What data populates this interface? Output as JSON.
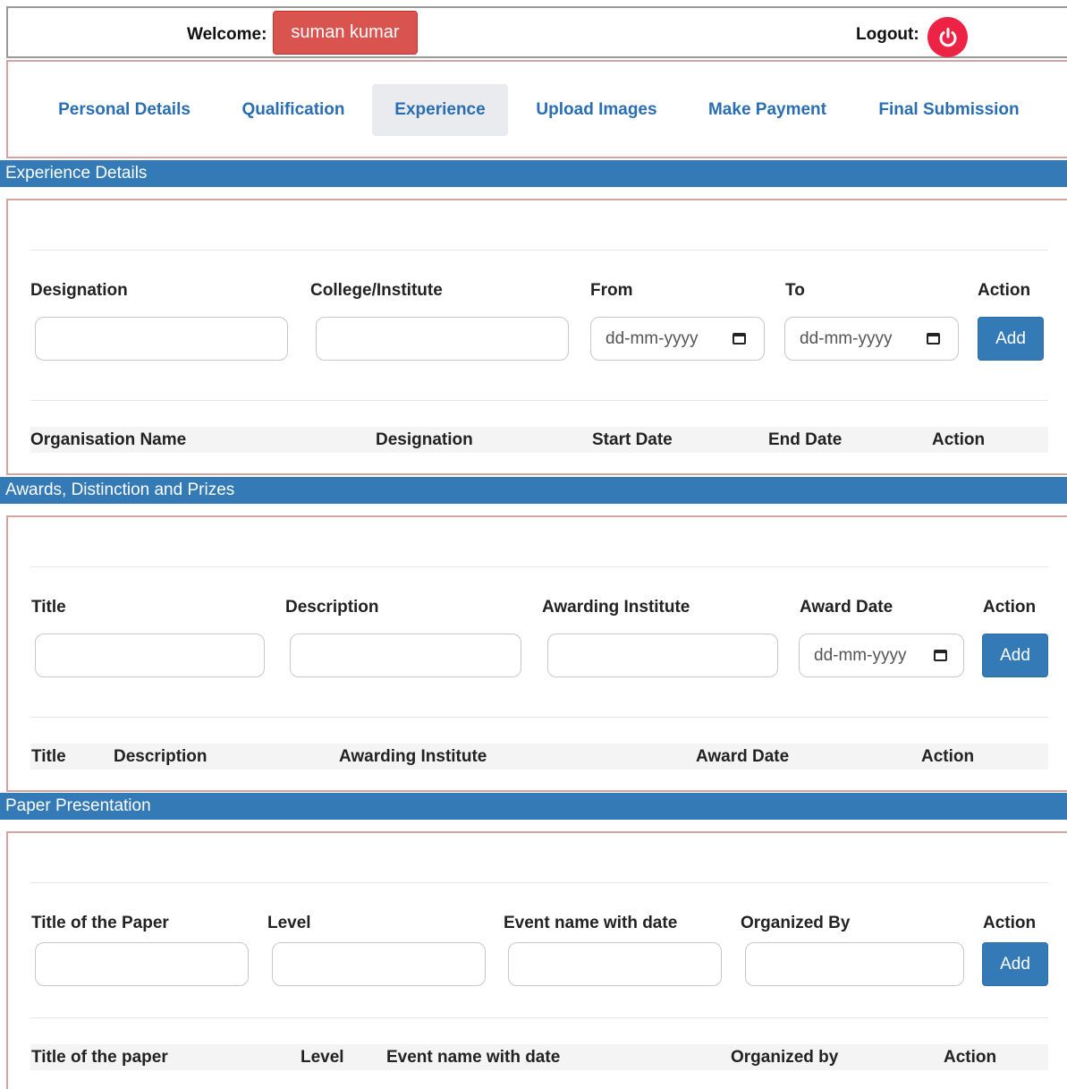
{
  "header": {
    "welcome_label": "Welcome:",
    "user_name": "suman kumar",
    "logout_label": "Logout:",
    "logout_icon": "power-icon"
  },
  "tabs": [
    {
      "label": "Personal Details",
      "active": false
    },
    {
      "label": "Qualification",
      "active": false
    },
    {
      "label": "Experience",
      "active": true
    },
    {
      "label": "Upload Images",
      "active": false
    },
    {
      "label": "Make Payment",
      "active": false
    },
    {
      "label": "Final Submission",
      "active": false
    }
  ],
  "experience": {
    "section_title": "Experience Details",
    "form_labels": [
      "Designation",
      "College/Institute",
      "From",
      "To",
      "Action"
    ],
    "from_placeholder": "dd-mm-yyyy",
    "to_placeholder": "dd-mm-yyyy",
    "add_label": "Add",
    "table_headers": [
      "Organisation Name",
      "Designation",
      "Start Date",
      "End Date",
      "Action"
    ]
  },
  "awards": {
    "section_title": "Awards, Distinction and Prizes",
    "form_labels": [
      "Title",
      "Description",
      "Awarding Institute",
      "Award Date",
      "Action"
    ],
    "date_placeholder": "dd-mm-yyyy",
    "add_label": "Add",
    "table_headers": [
      "Title",
      "Description",
      "Awarding Institute",
      "Award Date",
      "Action"
    ]
  },
  "papers": {
    "section_title": "Paper Presentation",
    "form_labels": [
      "Title of the Paper",
      "Level",
      "Event name with date",
      "Organized By",
      "Action"
    ],
    "add_label": "Add",
    "table_headers": [
      "Title of the paper",
      "Level",
      "Event name with date",
      "Organized by",
      "Action"
    ]
  },
  "colors": {
    "accent": "#337ab7",
    "danger": "#d9534f",
    "logout": "#ee2244",
    "panel_border": "#d7a2a2"
  }
}
